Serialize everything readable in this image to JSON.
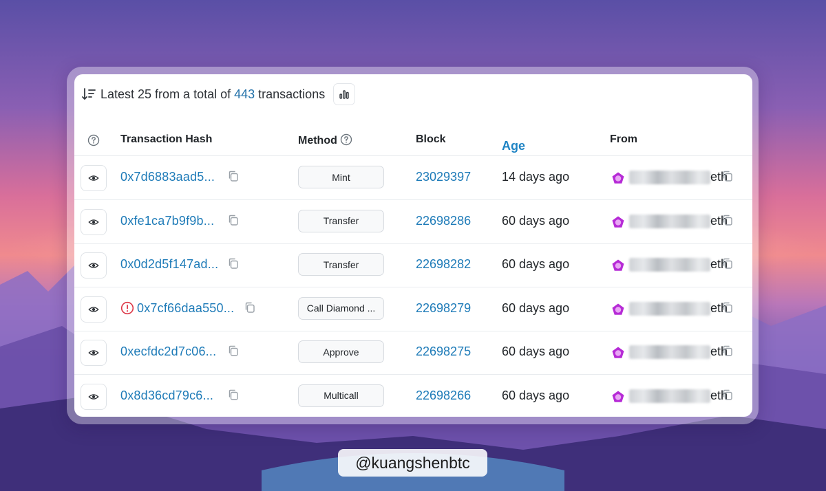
{
  "header": {
    "prefix": "Latest 25 from a total of",
    "total": "443",
    "suffix": "transactions"
  },
  "columns": {
    "hash": "Transaction Hash",
    "method": "Method",
    "block": "Block",
    "age": "Age",
    "from": "From"
  },
  "rows": [
    {
      "hash": "0x7d6883aad5...",
      "method": "Mint",
      "block": "23029397",
      "age": "14 days ago",
      "from_suffix": "eth",
      "error": false
    },
    {
      "hash": "0xfe1ca7b9f9b...",
      "method": "Transfer",
      "block": "22698286",
      "age": "60 days ago",
      "from_suffix": "eth",
      "error": false
    },
    {
      "hash": "0x0d2d5f147ad...",
      "method": "Transfer",
      "block": "22698282",
      "age": "60 days ago",
      "from_suffix": "eth",
      "error": false
    },
    {
      "hash": "0x7cf66daa550...",
      "method": "Call Diamond ...",
      "block": "22698279",
      "age": "60 days ago",
      "from_suffix": "eth",
      "error": true
    },
    {
      "hash": "0xecfdc2d7c06...",
      "method": "Approve",
      "block": "22698275",
      "age": "60 days ago",
      "from_suffix": "eth",
      "error": false
    },
    {
      "hash": "0x8d36cd79c6...",
      "method": "Multicall",
      "block": "22698266",
      "age": "60 days ago",
      "from_suffix": "eth",
      "error": false
    }
  ],
  "watermark": "@kuangshenbtc",
  "icons": {
    "sort": "sort-descending-icon",
    "chart": "bar-chart-icon",
    "help": "question-circle-icon",
    "view": "eye-icon",
    "copy": "copy-icon",
    "error": "error-circle-icon",
    "avatar": "pentagon-badge-icon"
  },
  "colors": {
    "link": "#1e7bb8",
    "age_header": "#1f84c4",
    "error": "#dc3545",
    "avatar": "#b62bd6"
  }
}
